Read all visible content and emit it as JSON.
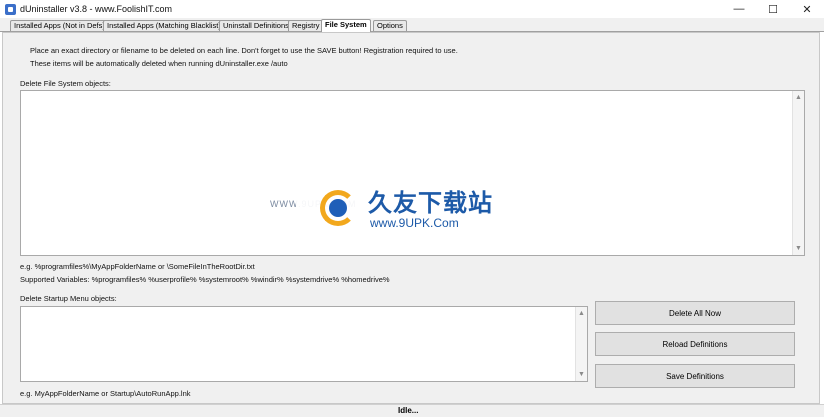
{
  "window": {
    "title": "dUninstaller v3.8   -   www.FoolishIT.com",
    "minimize_glyph": "—",
    "maximize_glyph": "☐",
    "close_glyph": "✕"
  },
  "tabs": [
    {
      "label": "Installed Apps (Not in Defs)",
      "active": false
    },
    {
      "label": "Installed Apps (Matching Blacklist)",
      "active": false
    },
    {
      "label": "Uninstall Definitions",
      "active": false
    },
    {
      "label": "Registry",
      "active": false
    },
    {
      "label": "File System",
      "active": true
    },
    {
      "label": "Options",
      "active": false
    }
  ],
  "file_system": {
    "info_line1": "Place an exact directory or filename to be deleted on each line.  Don't forget to use the SAVE button!  Registration required to use.",
    "info_line2": "These items will be automatically deleted when running dUninstaller.exe /auto",
    "delete_fs_label": "Delete File System objects:",
    "fs_example": "e.g.  %programfiles%\\MyAppFolderName    or    \\SomeFileInTheRootDir.txt",
    "supported_vars": "Supported Variables:  %programfiles% %userprofile% %systemroot% %windir% %systemdrive% %homedrive%",
    "delete_startup_label": "Delete Startup Menu objects:",
    "startup_example": "e.g.  MyAppFolderName    or    Startup\\AutoRunApp.lnk"
  },
  "buttons": {
    "delete_all_now": "Delete All Now",
    "reload_definitions": "Reload Definitions",
    "save_definitions": "Save Definitions"
  },
  "watermark": {
    "left_text": "WWW.9UPK.COM",
    "cn_text": "久友下载站",
    "url_text": "www.9UPK.Com"
  },
  "status": {
    "text": "Idle..."
  },
  "icons": {
    "app": "app-icon",
    "scroll_up": "▲",
    "scroll_down": "▼"
  }
}
